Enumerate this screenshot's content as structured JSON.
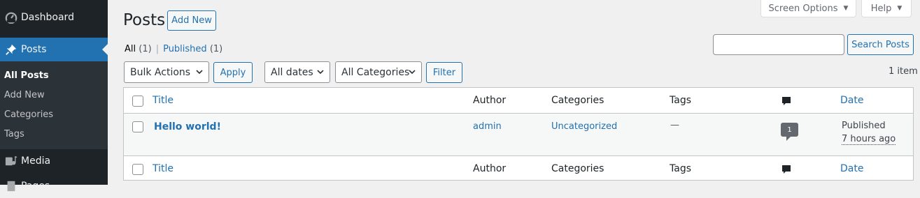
{
  "sidebar": {
    "dashboard": "Dashboard",
    "posts": "Posts",
    "submenu": [
      "All Posts",
      "Add New",
      "Categories",
      "Tags"
    ],
    "media": "Media",
    "pages": "Pages"
  },
  "top_tabs": {
    "screen_options": "Screen Options",
    "help": "Help"
  },
  "header": {
    "title": "Posts",
    "add_new": "Add New"
  },
  "views": {
    "all_label": "All",
    "all_count": "(1)",
    "published_label": "Published",
    "published_count": "(1)",
    "separator": "|"
  },
  "search": {
    "value": "",
    "button": "Search Posts"
  },
  "toolbar": {
    "bulk_actions": "Bulk Actions",
    "apply": "Apply",
    "dates": "All dates",
    "categories": "All Categories",
    "filter": "Filter",
    "item_count": "1 item"
  },
  "table": {
    "columns": {
      "title": "Title",
      "author": "Author",
      "categories": "Categories",
      "tags": "Tags",
      "date": "Date"
    },
    "rows": [
      {
        "title": "Hello world!",
        "author": "admin",
        "categories": "Uncategorized",
        "tags": "—",
        "comments": "1",
        "status": "Published",
        "date": "7 hours ago"
      }
    ]
  },
  "colors": {
    "accent": "#2271b1",
    "sidebar_bg": "#1d2327",
    "submenu_bg": "#2c3338",
    "page_bg": "#f0f0f1"
  }
}
